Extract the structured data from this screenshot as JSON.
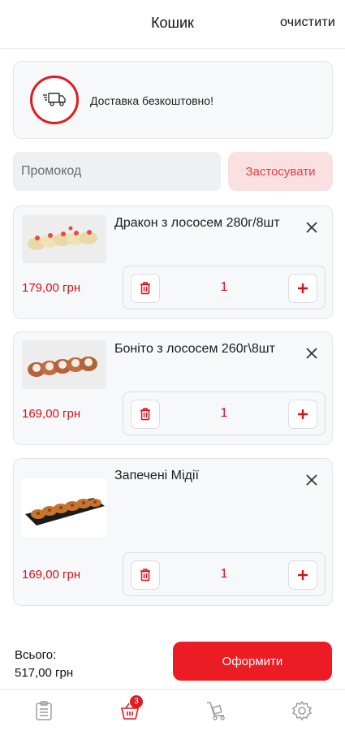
{
  "header": {
    "title": "Кошик",
    "clear_label": "очистити"
  },
  "delivery": {
    "text": "Доставка безкоштовно!",
    "icon": "delivery-truck-icon"
  },
  "promo": {
    "placeholder": "Промокод",
    "value": "",
    "apply_label": "Застосувати"
  },
  "cart": {
    "items": [
      {
        "name": "Дракон з лососем 280г/8шт",
        "price": "179,00 грн",
        "quantity": "1"
      },
      {
        "name": "Боніто з лососем 260г\\8шт",
        "price": "169,00 грн",
        "quantity": "1"
      },
      {
        "name": "Запечені Мідії",
        "price": "169,00 грн",
        "quantity": "1"
      }
    ]
  },
  "summary": {
    "total_label": "Всього:",
    "total_value": "517,00 грн",
    "checkout_label": "Оформити"
  },
  "nav": {
    "items": [
      {
        "icon": "menu-clipboard-icon"
      },
      {
        "icon": "cart-basket-icon",
        "badge": "3",
        "active": true
      },
      {
        "icon": "delivery-cart-icon"
      },
      {
        "icon": "settings-gear-icon"
      }
    ]
  },
  "colors": {
    "accent": "#ec1c24",
    "price": "#d8101a",
    "apply_bg": "#fbe0e1",
    "card_bg": "#f7f8fa"
  }
}
